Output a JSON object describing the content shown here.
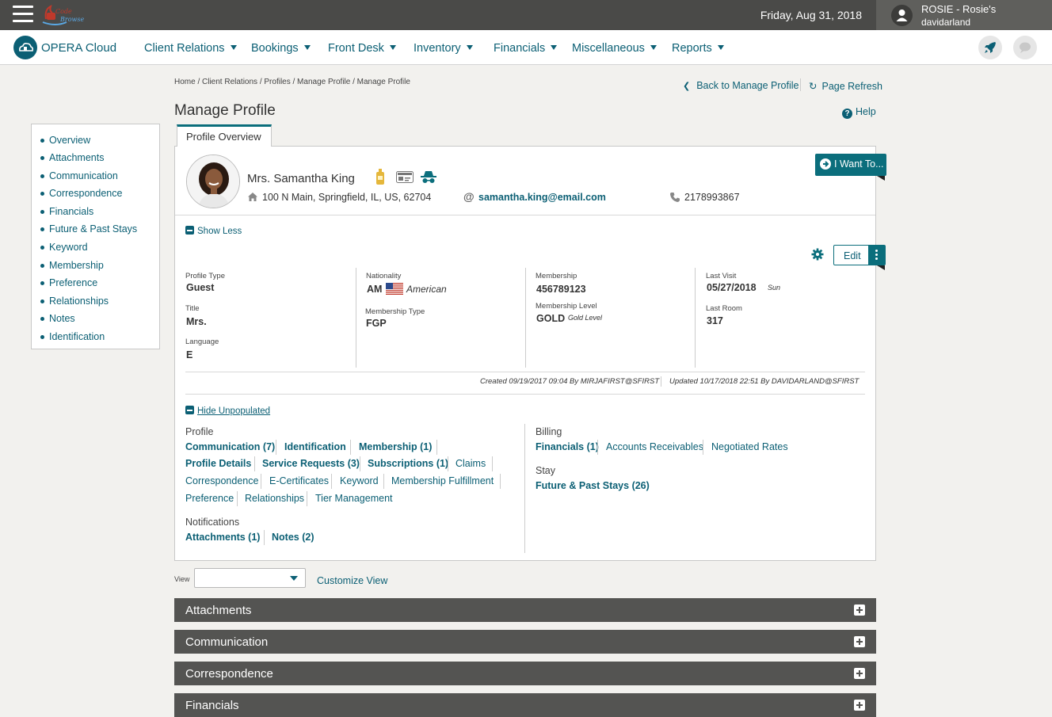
{
  "header": {
    "date": "Friday, Aug 31, 2018",
    "user_name": "ROSIE - Rosie's",
    "user_login": "davidarland",
    "brand": "OPERA Cloud"
  },
  "nav": {
    "items": [
      "Client Relations",
      "Bookings",
      "Front Desk",
      "Inventory",
      "Financials",
      "Miscellaneous",
      "Reports"
    ]
  },
  "breadcrumb": "Home / Client Relations / Profiles / Manage Profile / Manage Profile",
  "links": {
    "back": "Back to Manage Profile",
    "refresh": "Page Refresh",
    "help": "Help"
  },
  "page_title": "Manage Profile",
  "sidebar": {
    "items": [
      "Overview",
      "Attachments",
      "Communication",
      "Correspondence",
      "Financials",
      "Future & Past Stays",
      "Keyword",
      "Membership",
      "Preference",
      "Relationships",
      "Notes",
      "Identification"
    ]
  },
  "tab": "Profile Overview",
  "guest": {
    "name": "Mrs. Samantha King",
    "address": "100 N Main, Springfield, IL, US, 62704",
    "email": "samantha.king@email.com",
    "phone": "2178993867"
  },
  "actions": {
    "i_want_to": "I Want To...",
    "show_less": "Show Less",
    "edit": "Edit",
    "hide_unpopulated": "Hide Unpopulated",
    "customize_view": "Customize View"
  },
  "details": {
    "profile_type_label": "Profile Type",
    "profile_type": "Guest",
    "title_label": "Title",
    "title": "Mrs.",
    "language_label": "Language",
    "language": "E",
    "nationality_label": "Nationality",
    "nationality_code": "AM",
    "nationality": "American",
    "membership_type_label": "Membership Type",
    "membership_type": "FGP",
    "membership_label": "Membership",
    "membership": "456789123",
    "membership_level_label": "Membership Level",
    "membership_level": "GOLD",
    "membership_level_desc": "Gold Level",
    "last_visit_label": "Last Visit",
    "last_visit": "05/27/2018",
    "last_visit_day": "Sun",
    "last_room_label": "Last Room",
    "last_room": "317"
  },
  "audit": {
    "created": "Created  09/19/2017 09:04  By  MIRJAFIRST@SFIRST",
    "updated": "Updated  10/17/2018 22:51  By  DAVIDARLAND@SFIRST"
  },
  "sections": {
    "profile_heading": "Profile",
    "profile_row1": [
      "Communication (7)",
      "Identification",
      "Membership (1)"
    ],
    "profile_row2": [
      "Profile Details",
      "Service Requests (3)",
      "Subscriptions (1)",
      "Claims"
    ],
    "profile_row3": [
      "Correspondence",
      "E-Certificates",
      "Keyword",
      "Membership Fulfillment"
    ],
    "profile_row4": [
      "Preference",
      "Relationships",
      "Tier Management"
    ],
    "notifications_heading": "Notifications",
    "notifications": [
      "Attachments (1)",
      "Notes (2)"
    ],
    "billing_heading": "Billing",
    "billing": [
      "Financials (1)",
      "Accounts Receivables",
      "Negotiated Rates"
    ],
    "stay_heading": "Stay",
    "stay": [
      "Future & Past Stays (26)"
    ]
  },
  "view": {
    "label": "View",
    "selected": ""
  },
  "panels": [
    "Attachments",
    "Communication",
    "Correspondence",
    "Financials"
  ]
}
